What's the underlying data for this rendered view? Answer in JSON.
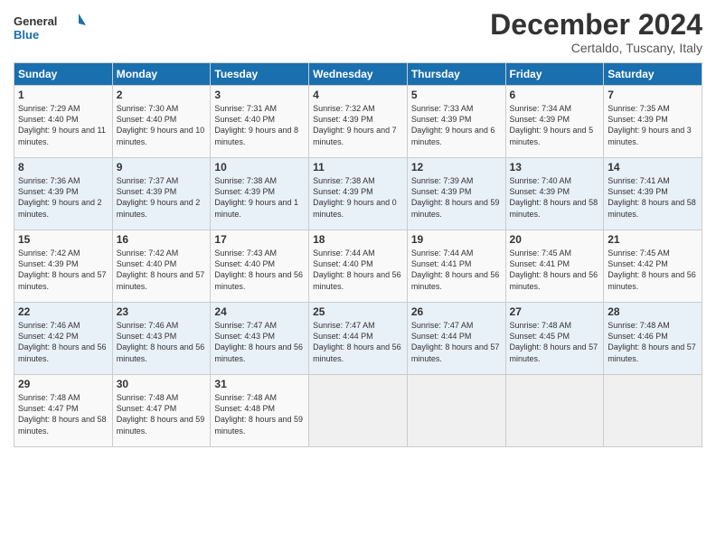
{
  "logo": {
    "line1": "General",
    "line2": "Blue"
  },
  "title": "December 2024",
  "location": "Certaldo, Tuscany, Italy",
  "headers": [
    "Sunday",
    "Monday",
    "Tuesday",
    "Wednesday",
    "Thursday",
    "Friday",
    "Saturday"
  ],
  "weeks": [
    [
      {
        "day": "1",
        "sunrise": "7:29 AM",
        "sunset": "4:40 PM",
        "daylight": "9 hours and 11 minutes."
      },
      {
        "day": "2",
        "sunrise": "7:30 AM",
        "sunset": "4:40 PM",
        "daylight": "9 hours and 10 minutes."
      },
      {
        "day": "3",
        "sunrise": "7:31 AM",
        "sunset": "4:40 PM",
        "daylight": "9 hours and 8 minutes."
      },
      {
        "day": "4",
        "sunrise": "7:32 AM",
        "sunset": "4:39 PM",
        "daylight": "9 hours and 7 minutes."
      },
      {
        "day": "5",
        "sunrise": "7:33 AM",
        "sunset": "4:39 PM",
        "daylight": "9 hours and 6 minutes."
      },
      {
        "day": "6",
        "sunrise": "7:34 AM",
        "sunset": "4:39 PM",
        "daylight": "9 hours and 5 minutes."
      },
      {
        "day": "7",
        "sunrise": "7:35 AM",
        "sunset": "4:39 PM",
        "daylight": "9 hours and 3 minutes."
      }
    ],
    [
      {
        "day": "8",
        "sunrise": "7:36 AM",
        "sunset": "4:39 PM",
        "daylight": "9 hours and 2 minutes."
      },
      {
        "day": "9",
        "sunrise": "7:37 AM",
        "sunset": "4:39 PM",
        "daylight": "9 hours and 2 minutes."
      },
      {
        "day": "10",
        "sunrise": "7:38 AM",
        "sunset": "4:39 PM",
        "daylight": "9 hours and 1 minute."
      },
      {
        "day": "11",
        "sunrise": "7:38 AM",
        "sunset": "4:39 PM",
        "daylight": "9 hours and 0 minutes."
      },
      {
        "day": "12",
        "sunrise": "7:39 AM",
        "sunset": "4:39 PM",
        "daylight": "8 hours and 59 minutes."
      },
      {
        "day": "13",
        "sunrise": "7:40 AM",
        "sunset": "4:39 PM",
        "daylight": "8 hours and 58 minutes."
      },
      {
        "day": "14",
        "sunrise": "7:41 AM",
        "sunset": "4:39 PM",
        "daylight": "8 hours and 58 minutes."
      }
    ],
    [
      {
        "day": "15",
        "sunrise": "7:42 AM",
        "sunset": "4:39 PM",
        "daylight": "8 hours and 57 minutes."
      },
      {
        "day": "16",
        "sunrise": "7:42 AM",
        "sunset": "4:40 PM",
        "daylight": "8 hours and 57 minutes."
      },
      {
        "day": "17",
        "sunrise": "7:43 AM",
        "sunset": "4:40 PM",
        "daylight": "8 hours and 56 minutes."
      },
      {
        "day": "18",
        "sunrise": "7:44 AM",
        "sunset": "4:40 PM",
        "daylight": "8 hours and 56 minutes."
      },
      {
        "day": "19",
        "sunrise": "7:44 AM",
        "sunset": "4:41 PM",
        "daylight": "8 hours and 56 minutes."
      },
      {
        "day": "20",
        "sunrise": "7:45 AM",
        "sunset": "4:41 PM",
        "daylight": "8 hours and 56 minutes."
      },
      {
        "day": "21",
        "sunrise": "7:45 AM",
        "sunset": "4:42 PM",
        "daylight": "8 hours and 56 minutes."
      }
    ],
    [
      {
        "day": "22",
        "sunrise": "7:46 AM",
        "sunset": "4:42 PM",
        "daylight": "8 hours and 56 minutes."
      },
      {
        "day": "23",
        "sunrise": "7:46 AM",
        "sunset": "4:43 PM",
        "daylight": "8 hours and 56 minutes."
      },
      {
        "day": "24",
        "sunrise": "7:47 AM",
        "sunset": "4:43 PM",
        "daylight": "8 hours and 56 minutes."
      },
      {
        "day": "25",
        "sunrise": "7:47 AM",
        "sunset": "4:44 PM",
        "daylight": "8 hours and 56 minutes."
      },
      {
        "day": "26",
        "sunrise": "7:47 AM",
        "sunset": "4:44 PM",
        "daylight": "8 hours and 57 minutes."
      },
      {
        "day": "27",
        "sunrise": "7:48 AM",
        "sunset": "4:45 PM",
        "daylight": "8 hours and 57 minutes."
      },
      {
        "day": "28",
        "sunrise": "7:48 AM",
        "sunset": "4:46 PM",
        "daylight": "8 hours and 57 minutes."
      }
    ],
    [
      {
        "day": "29",
        "sunrise": "7:48 AM",
        "sunset": "4:47 PM",
        "daylight": "8 hours and 58 minutes."
      },
      {
        "day": "30",
        "sunrise": "7:48 AM",
        "sunset": "4:47 PM",
        "daylight": "8 hours and 59 minutes."
      },
      {
        "day": "31",
        "sunrise": "7:48 AM",
        "sunset": "4:48 PM",
        "daylight": "8 hours and 59 minutes."
      },
      null,
      null,
      null,
      null
    ]
  ],
  "labels": {
    "sunrise": "Sunrise:",
    "sunset": "Sunset:",
    "daylight": "Daylight:"
  }
}
